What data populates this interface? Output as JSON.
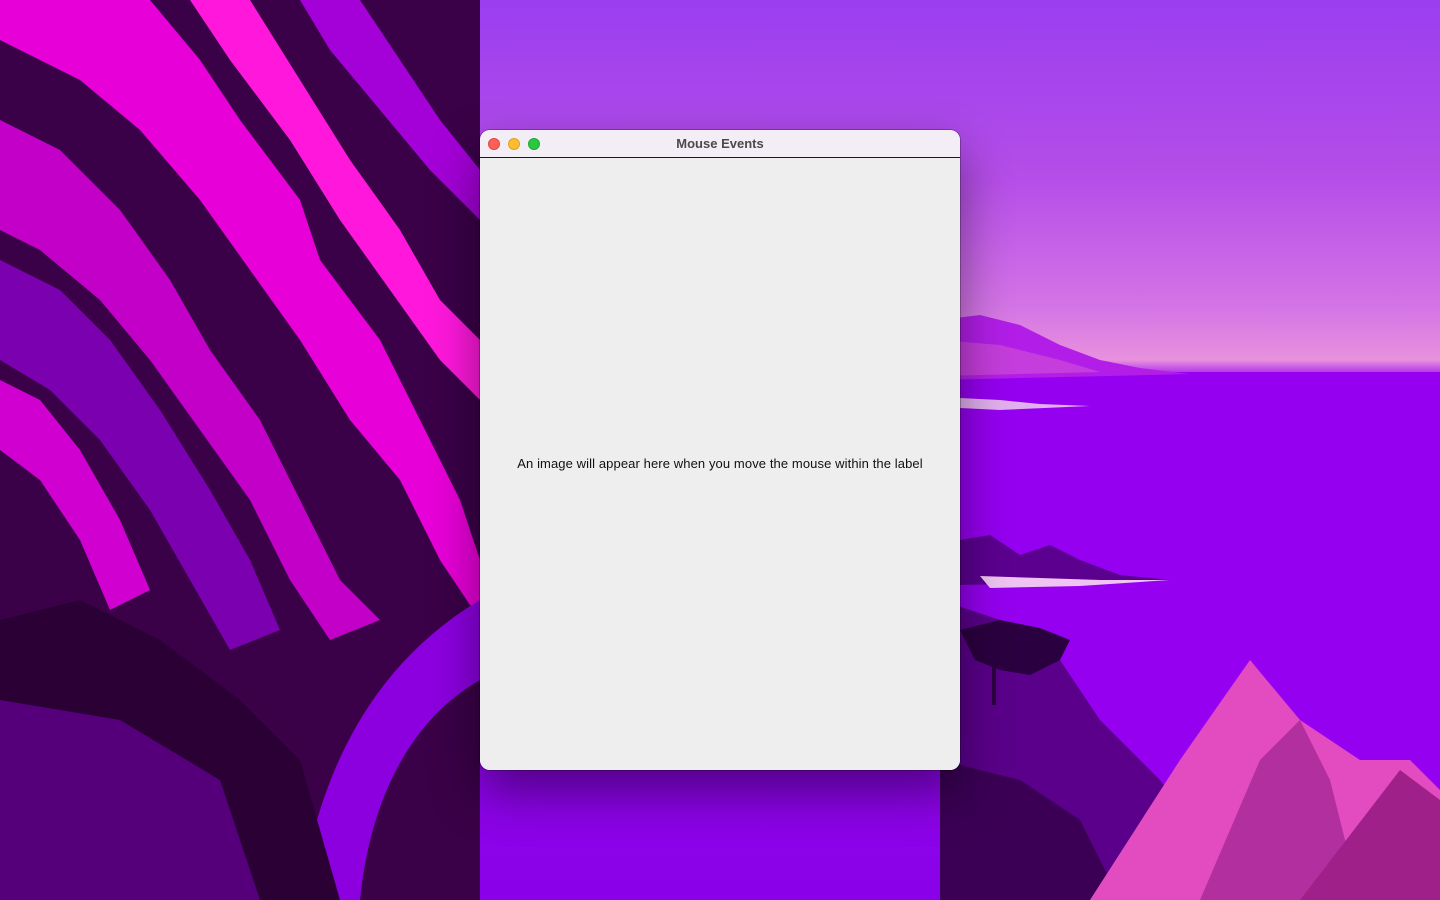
{
  "window": {
    "title": "Mouse Events",
    "controls": {
      "close": "close-button",
      "minimize": "minimize-button",
      "zoom": "zoom-button"
    }
  },
  "content": {
    "label_text": "An image will appear here when you move the mouse within the label"
  },
  "colors": {
    "close": "#fe5f57",
    "minimize": "#febc2e",
    "zoom": "#28c840",
    "wallpaper_magenta": "#ff2bd6",
    "wallpaper_purple": "#8a00e8"
  }
}
